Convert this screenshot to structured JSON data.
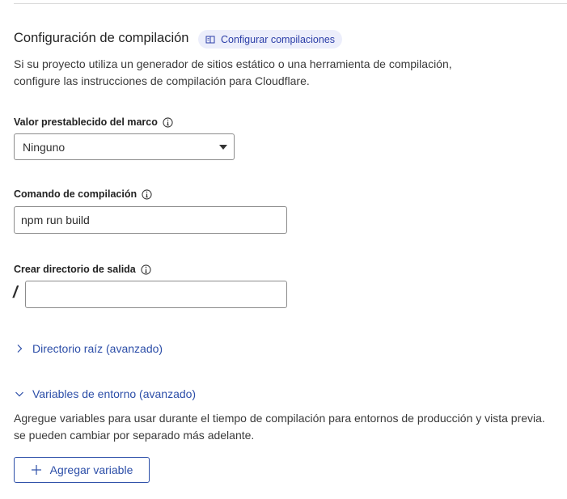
{
  "section": {
    "title": "Configuración de compilación",
    "link_label": "Configurar compilaciones",
    "description_lines": [
      "Si su proyecto utiliza un generador de sitios estático o una herramienta de compilación,",
      "configure las instrucciones de compilación para Cloudflare."
    ]
  },
  "framework": {
    "label": "Valor prestablecido del marco",
    "selected": "Ninguno"
  },
  "build_command": {
    "label": "Comando de compilación",
    "value": "npm run build"
  },
  "output_dir": {
    "label": "Crear directorio de salida",
    "prefix": "/",
    "value": ""
  },
  "root_dir": {
    "label": "Directorio raíz (avanzado)",
    "expanded": false
  },
  "env_vars": {
    "label": "Variables de entorno (avanzado)",
    "expanded": true,
    "description_lines": [
      "Agregue variables para usar durante el tiempo de compilación para entornos de producción y vista previa.",
      "se pueden cambiar por separado más adelante."
    ],
    "add_button": "Agregar variable"
  },
  "colors": {
    "accent": "#2c4ea8",
    "pill_bg": "#eceefb"
  },
  "icons": [
    "book-icon",
    "info-icon",
    "chevron-right-icon",
    "chevron-down-icon",
    "plus-icon",
    "caret-down-icon"
  ]
}
